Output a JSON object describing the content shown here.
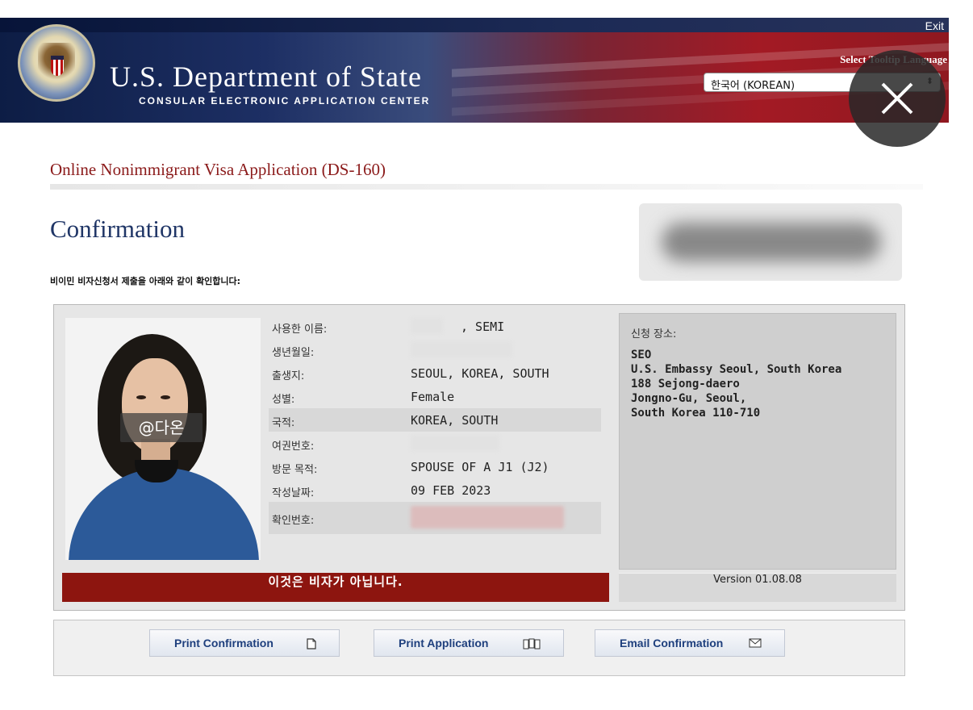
{
  "header": {
    "exit_label": "Exit",
    "dept_title": "U.S. Department of State",
    "dept_subtitle": "CONSULAR ELECTRONIC APPLICATION CENTER",
    "tooltip_language_label": "Select Tooltip Language",
    "tooltip_language_value": "한국어 (KOREAN)"
  },
  "page": {
    "app_title": "Online Nonimmigrant Visa Application (DS-160)",
    "title": "Confirmation",
    "intro": "비이민 비자신청서 제출을 아래와 같이 확인합니다:"
  },
  "photo": {
    "watermark": "@다온"
  },
  "applicant": {
    "name_label": "사용한 이름:",
    "name_value": ", SEMI",
    "dob_label": "생년월일:",
    "pob_label": "출생지:",
    "pob_value": "SEOUL, KOREA, SOUTH",
    "gender_label": "성별:",
    "gender_value": "Female",
    "nationality_label": "국적:",
    "nationality_value": "KOREA, SOUTH",
    "passport_label": "여권번호:",
    "purpose_label": "방문 목적:",
    "purpose_value": "SPOUSE OF A J1 (J2)",
    "date_label": "작성날짜:",
    "date_value": "09 FEB 2023",
    "confirm_label": "확인번호:"
  },
  "location": {
    "label": "신청 장소:",
    "lines": [
      "SEO",
      "U.S. Embassy Seoul, South Korea",
      "188 Sejong-daero",
      "Jongno-Gu, Seoul,",
      "South Korea 110-710"
    ]
  },
  "notice": "이것은 비자가 아닙니다.",
  "version": "Version 01.08.08",
  "actions": {
    "print_confirmation": "Print Confirmation",
    "print_application": "Print Application",
    "email_confirmation": "Email Confirmation"
  },
  "colors": {
    "brand_red": "#8d150f",
    "title_blue": "#1f3566",
    "link_blue": "#1e3f7d"
  }
}
